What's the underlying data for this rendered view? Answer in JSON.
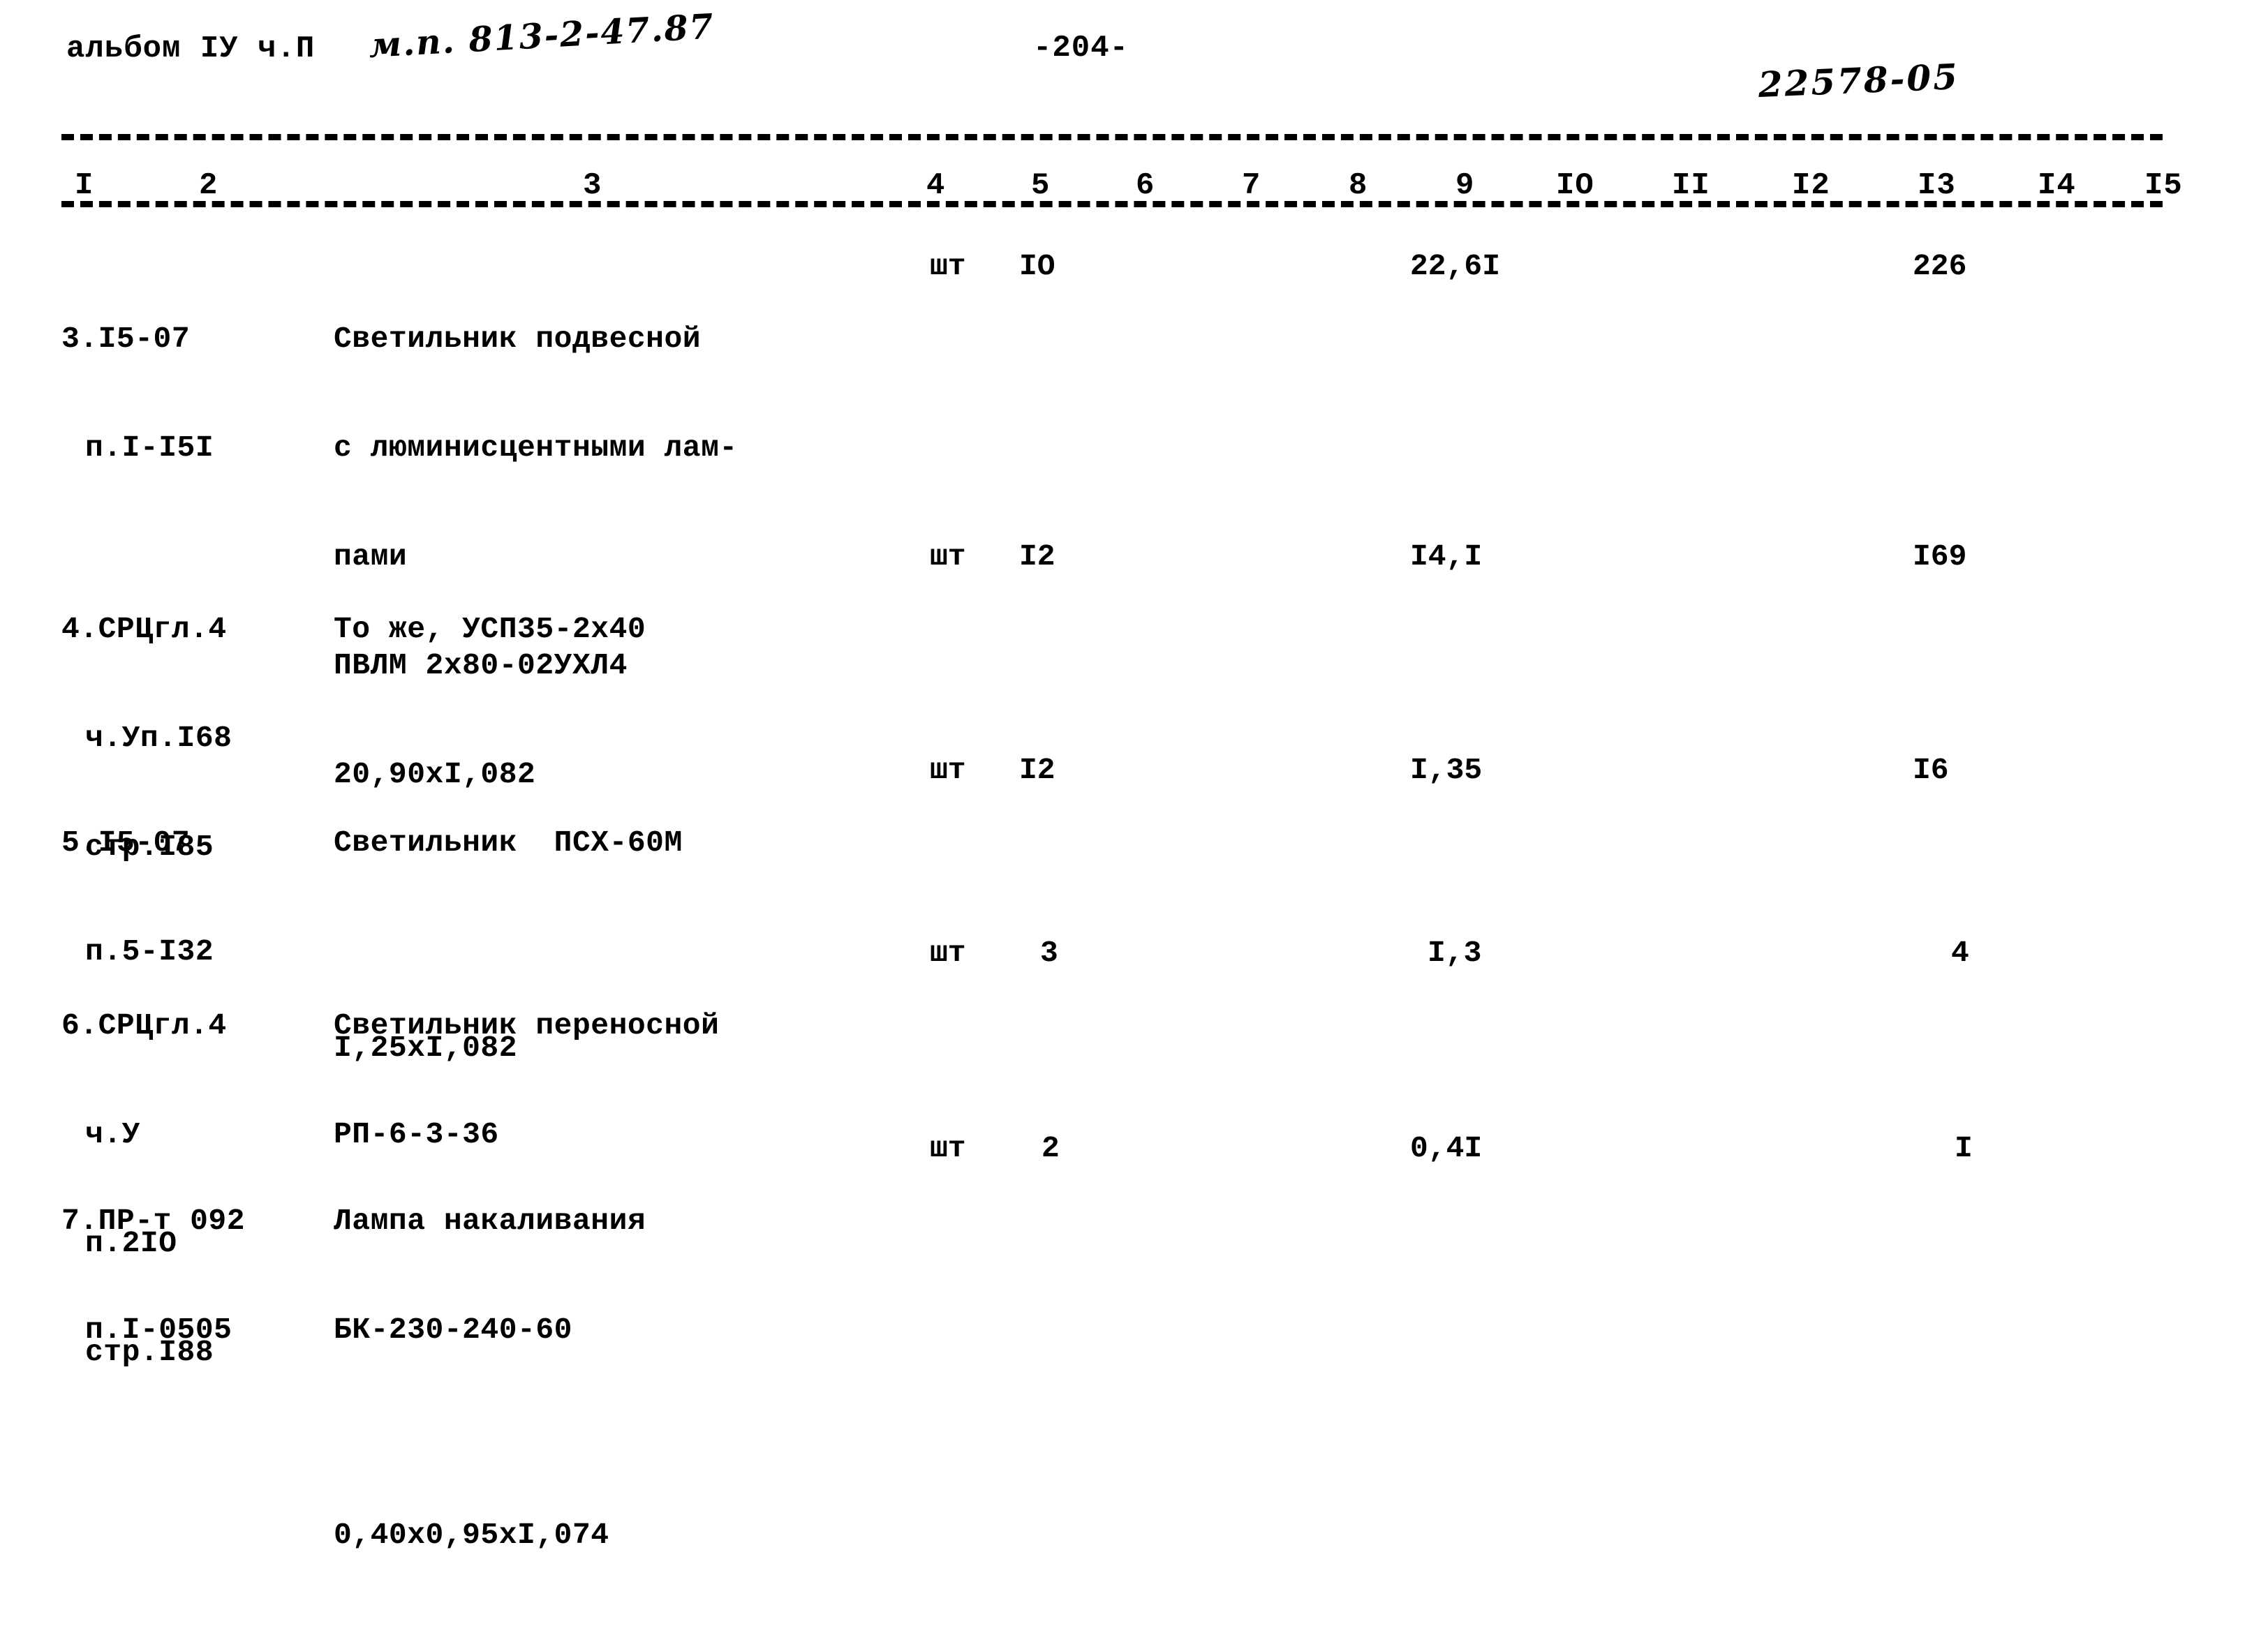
{
  "document": {
    "header_left": "альбом IУ ч.П",
    "header_handwritten_spec": "м.п. 813-2-47.87",
    "page_number": "-204-",
    "header_handwritten_code": "22578-05"
  },
  "table": {
    "column_numbers": [
      "I",
      "2",
      "3",
      "4",
      "5",
      "6",
      "7",
      "8",
      "9",
      "IO",
      "II",
      "I2",
      "I3",
      "I4",
      "I5"
    ],
    "rows": [
      {
        "code_lines": [
          "3.I5-07",
          "п.I-I5I"
        ],
        "description_lines": [
          "Светильник подвесной",
          "с люминисцентными лам-",
          "пами",
          "ПВЛМ 2х80-02УХЛ4",
          "20,90хI,082"
        ],
        "unit": "шт",
        "quantity": "IO",
        "price": "22,6I",
        "total": "226"
      },
      {
        "code_lines": [
          "4.СРЦгл.4",
          "ч.Уп.I68",
          "стр.I85"
        ],
        "description_lines": [
          "То же, УСП35-2х40"
        ],
        "unit": "шт",
        "quantity": "I2",
        "price": "I4,I",
        "total": "I69"
      },
      {
        "code_lines": [
          "5.I5-07",
          "п.5-I32"
        ],
        "description_lines": [
          "Светильник  ПСХ-60М",
          "",
          "I,25хI,082"
        ],
        "unit": "шт",
        "quantity": "I2",
        "price": "I,35",
        "total": "I6"
      },
      {
        "code_lines": [
          "6.СРЦгл.4",
          "ч.У",
          "п.2IO",
          "стр.I88"
        ],
        "description_lines": [
          "Светильник переносной",
          "РП-6-3-36"
        ],
        "unit": "шт",
        "quantity": "3",
        "price": "I,3",
        "total": "4"
      },
      {
        "code_lines": [
          "7.ПР-т 092",
          "п.I-0505"
        ],
        "description_lines": [
          "Лампа накаливания",
          "БК-230-240-60",
          "",
          "0,40х0,95хI,074"
        ],
        "unit": "шт",
        "quantity": "2",
        "price": "0,4I",
        "total": "I"
      }
    ]
  }
}
